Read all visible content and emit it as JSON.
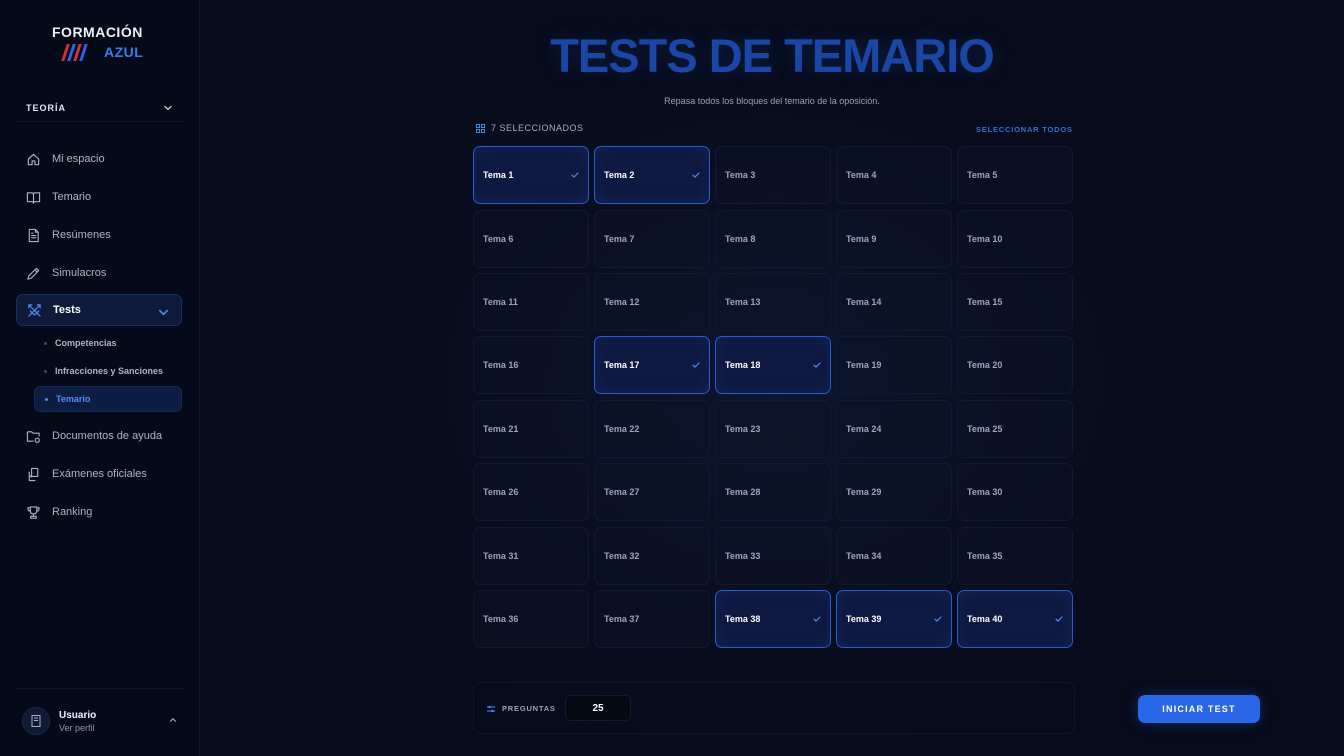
{
  "brand": {
    "top": "FORMACIÓN",
    "bottom": "AZUL",
    "stripe_colors": [
      "#d6303a",
      "#2a66e8",
      "#d6303a",
      "#2a66e8"
    ]
  },
  "sidebar": {
    "section": "TEORÍA",
    "items": [
      {
        "label": "Mi espacio",
        "icon": "home-icon"
      },
      {
        "label": "Temario",
        "icon": "book-icon"
      },
      {
        "label": "Resúmenes",
        "icon": "document-icon"
      },
      {
        "label": "Simulacros",
        "icon": "pencil-icon"
      },
      {
        "label": "Tests",
        "icon": "swords-icon",
        "active": true
      },
      {
        "label": "Documentos de ayuda",
        "icon": "folder-settings-icon"
      },
      {
        "label": "Exámenes oficiales",
        "icon": "files-icon"
      },
      {
        "label": "Ranking",
        "icon": "trophy-icon"
      }
    ],
    "sub_items": [
      {
        "label": "Competencias"
      },
      {
        "label": "Infracciones y Sanciones"
      },
      {
        "label": "Temario",
        "active": true
      }
    ],
    "user": {
      "name": "Usuario",
      "link": "Ver perfil"
    }
  },
  "main": {
    "title": "TESTS DE TEMARIO",
    "subtitle": "Repasa todos los bloques del temario de la oposición.",
    "selected_count": "7 SELECCIONADOS",
    "select_all": "SELECCIONAR TODOS",
    "tiles": [
      {
        "label": "Tema 1",
        "selected": true
      },
      {
        "label": "Tema 2",
        "selected": true
      },
      {
        "label": "Tema 3",
        "selected": false
      },
      {
        "label": "Tema 4",
        "selected": false
      },
      {
        "label": "Tema 5",
        "selected": false
      },
      {
        "label": "Tema 6",
        "selected": false
      },
      {
        "label": "Tema 7",
        "selected": false
      },
      {
        "label": "Tema 8",
        "selected": false
      },
      {
        "label": "Tema 9",
        "selected": false
      },
      {
        "label": "Tema 10",
        "selected": false
      },
      {
        "label": "Tema 11",
        "selected": false
      },
      {
        "label": "Tema 12",
        "selected": false
      },
      {
        "label": "Tema 13",
        "selected": false
      },
      {
        "label": "Tema 14",
        "selected": false
      },
      {
        "label": "Tema 15",
        "selected": false
      },
      {
        "label": "Tema 16",
        "selected": false
      },
      {
        "label": "Tema 17",
        "selected": true
      },
      {
        "label": "Tema 18",
        "selected": true
      },
      {
        "label": "Tema 19",
        "selected": false
      },
      {
        "label": "Tema 20",
        "selected": false
      },
      {
        "label": "Tema 21",
        "selected": false
      },
      {
        "label": "Tema 22",
        "selected": false
      },
      {
        "label": "Tema 23",
        "selected": false
      },
      {
        "label": "Tema 24",
        "selected": false
      },
      {
        "label": "Tema 25",
        "selected": false
      },
      {
        "label": "Tema 26",
        "selected": false
      },
      {
        "label": "Tema 27",
        "selected": false
      },
      {
        "label": "Tema 28",
        "selected": false
      },
      {
        "label": "Tema 29",
        "selected": false
      },
      {
        "label": "Tema 30",
        "selected": false
      },
      {
        "label": "Tema 31",
        "selected": false
      },
      {
        "label": "Tema 32",
        "selected": false
      },
      {
        "label": "Tema 33",
        "selected": false
      },
      {
        "label": "Tema 34",
        "selected": false
      },
      {
        "label": "Tema 35",
        "selected": false
      },
      {
        "label": "Tema 36",
        "selected": false
      },
      {
        "label": "Tema 37",
        "selected": false
      },
      {
        "label": "Tema 38",
        "selected": true
      },
      {
        "label": "Tema 39",
        "selected": true
      },
      {
        "label": "Tema 40",
        "selected": true
      }
    ],
    "questions": {
      "label": "PREGUNTAS",
      "value": "25"
    },
    "start_button": "INICIAR TEST"
  }
}
